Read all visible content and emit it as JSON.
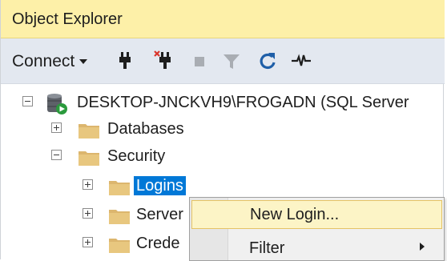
{
  "panel": {
    "title": "Object Explorer"
  },
  "toolbar": {
    "connect_label": "Connect",
    "buttons": [
      "connect-plug-icon",
      "disconnect-icon",
      "stop-icon",
      "filter-icon",
      "refresh-icon",
      "activity-monitor-icon"
    ]
  },
  "tree": {
    "server": "DESKTOP-JNCKVH9\\FROGADN (SQL Server",
    "databases": "Databases",
    "security": "Security",
    "logins": "Logins",
    "server_roles": "Server",
    "credentials": "Crede"
  },
  "context_menu": {
    "new_login": "New Login...",
    "filter": "Filter"
  },
  "colors": {
    "title_bg": "#fdf0a8",
    "toolbar_bg": "#e3e8f0",
    "selection": "#0078d7",
    "folder": "#dcb66e",
    "menu_hover": "#fcf4c6"
  }
}
